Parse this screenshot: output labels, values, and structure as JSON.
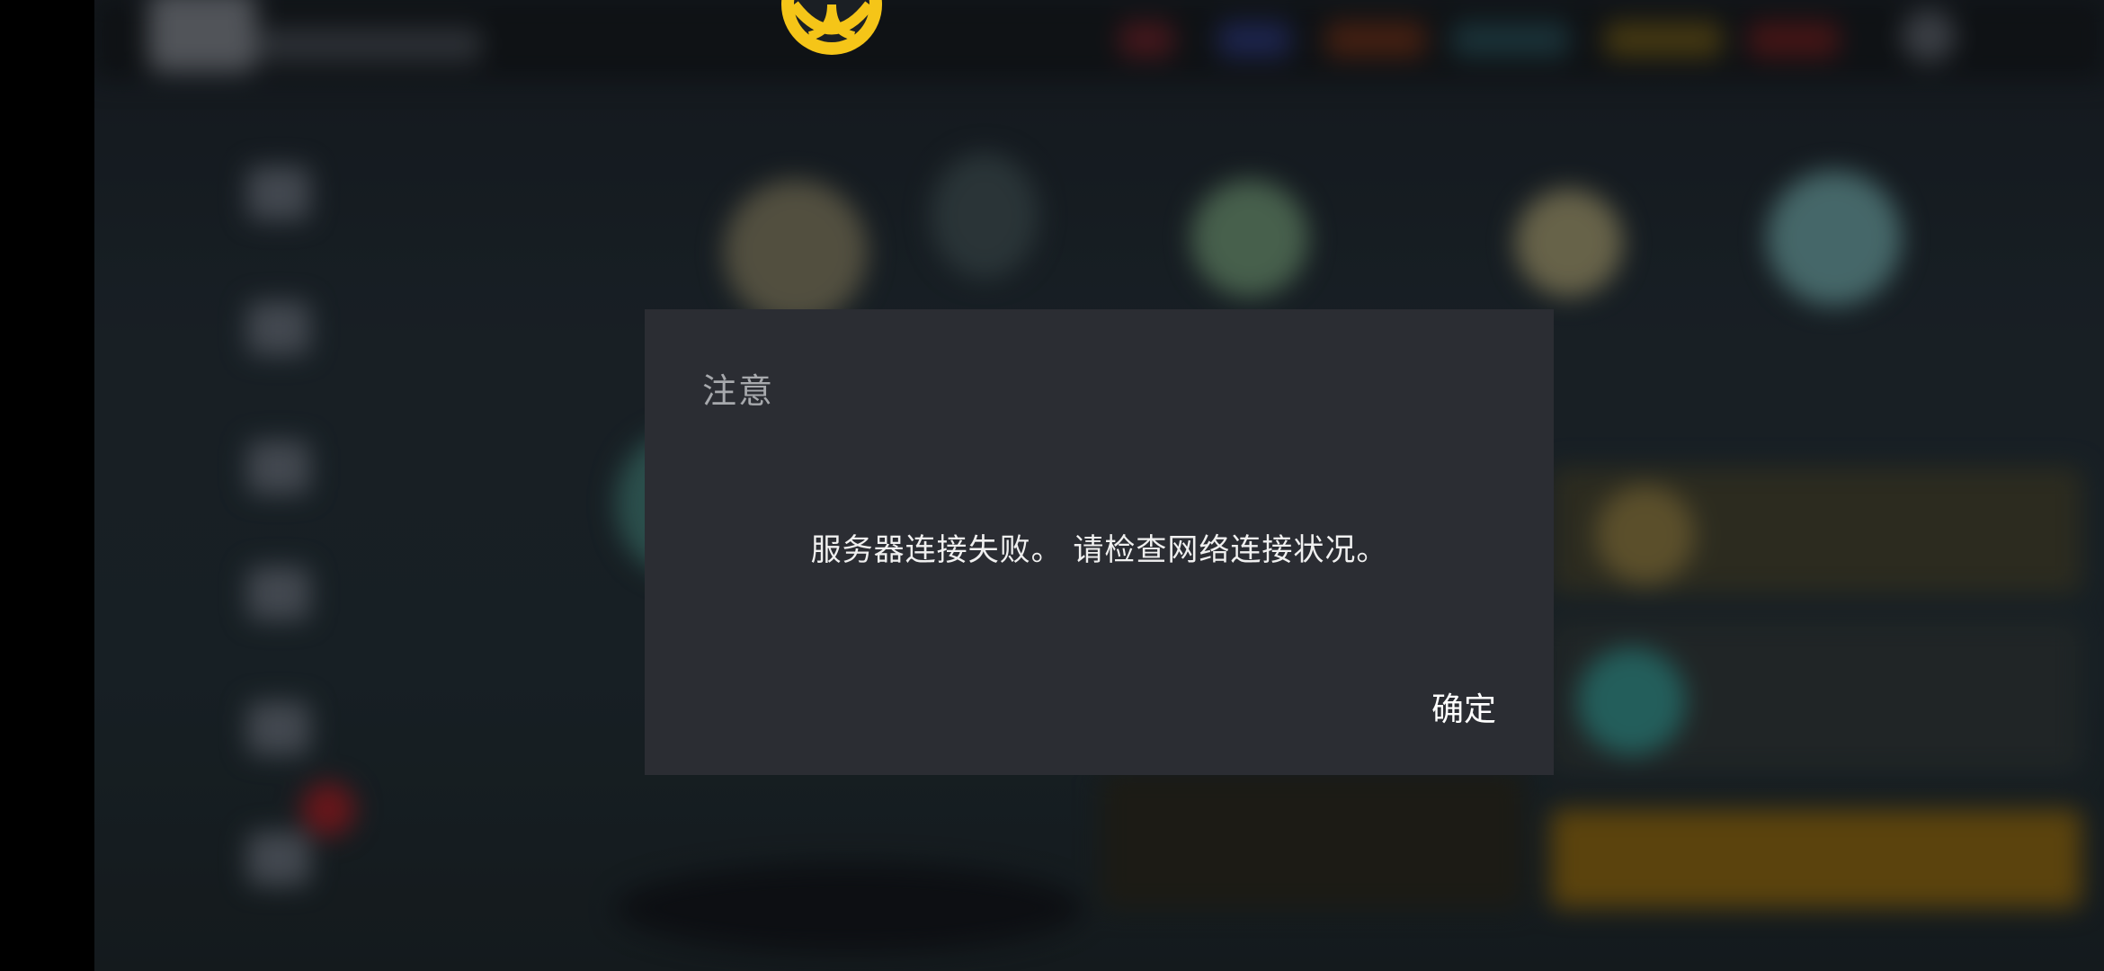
{
  "dialog": {
    "title": "注意",
    "message": "服务器连接失败。 请检查网络连接状况。",
    "ok_label": "确定"
  },
  "colors": {
    "dialog_bg": "#2b2d33",
    "logo_accent": "#f5c518"
  },
  "icons": {
    "logo": "game-logo-icon"
  }
}
